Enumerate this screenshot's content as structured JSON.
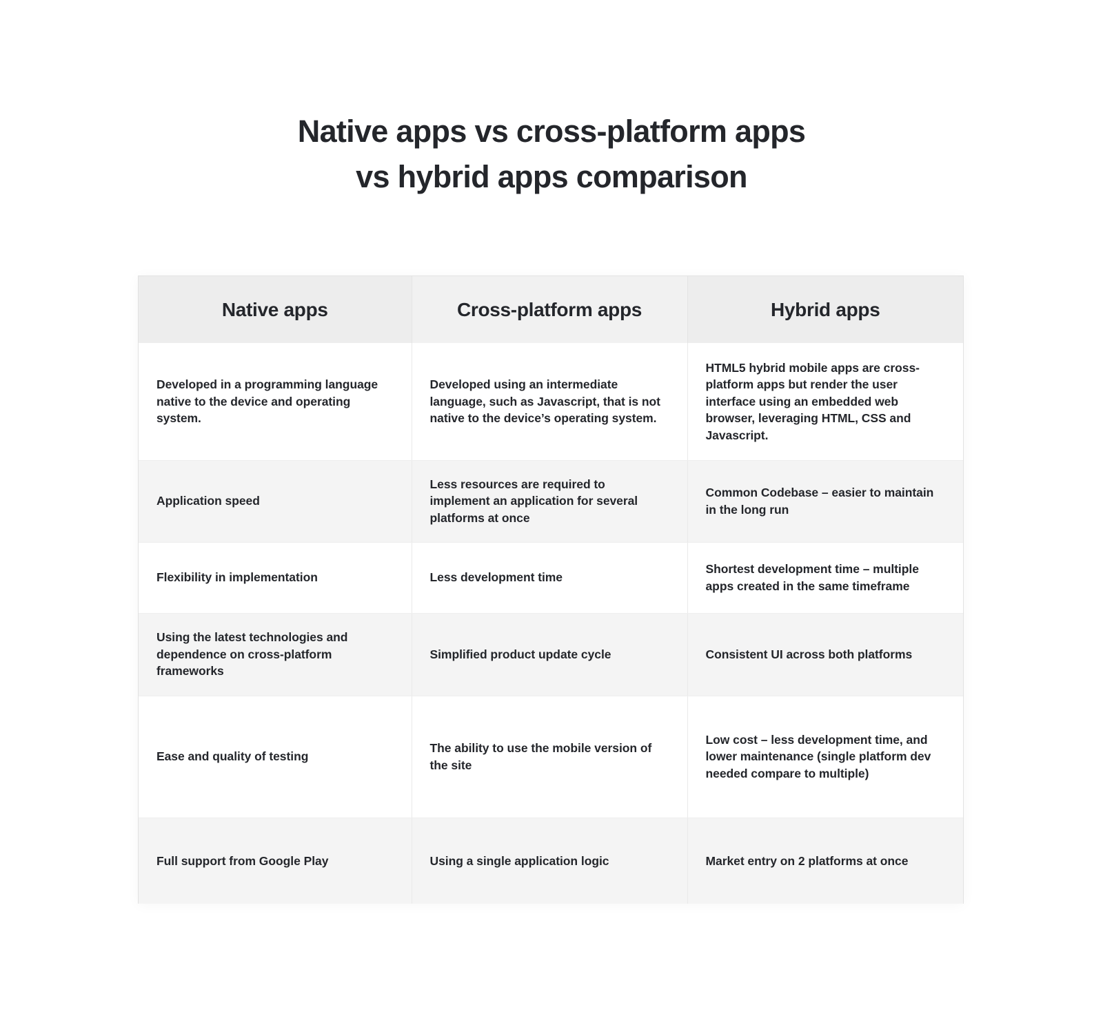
{
  "title": {
    "line1": "Native apps vs cross-platform apps",
    "line2": "vs hybrid apps comparison"
  },
  "colors": {
    "page_background": "#ffffff",
    "text": "#24262b",
    "header_background_outer": "#ededed",
    "header_background_middle": "#f1f1f1",
    "row_shade": "#f4f4f4",
    "row_plain": "#ffffff",
    "border": "#e4e4e4"
  },
  "table": {
    "headers": [
      "Native apps",
      "Cross-platform apps",
      "Hybrid apps"
    ],
    "rows": [
      {
        "native": "Developed in a programming language native to the device and operating system.",
        "cross_platform": "Developed using an intermediate language, such as Javascript, that is not native to the device’s operating system.",
        "hybrid": "HTML5 hybrid mobile apps are cross-platform apps but render the user interface using an embedded web browser, leveraging HTML, CSS and Javascript."
      },
      {
        "native": "Application speed",
        "cross_platform": "Less resources are required to implement an application for several platforms at once",
        "hybrid": "Common Codebase – easier to maintain in the long run"
      },
      {
        "native": "Flexibility in implementation",
        "cross_platform": "Less development time",
        "hybrid": "Shortest development time – multiple apps created in the same timeframe"
      },
      {
        "native": "Using the latest technologies and dependence on cross-platform frameworks",
        "cross_platform": "Simplified product update cycle",
        "hybrid": "Consistent UI across both platforms"
      },
      {
        "native": "Ease and quality of testing",
        "cross_platform": "The ability to use the mobile version of the site",
        "hybrid": "Low cost – less development time, and lower maintenance (single platform dev needed compare to multiple)"
      },
      {
        "native": "Full support from Google Play",
        "cross_platform": "Using a single application logic",
        "hybrid": "Market entry on 2 platforms at once"
      }
    ]
  }
}
